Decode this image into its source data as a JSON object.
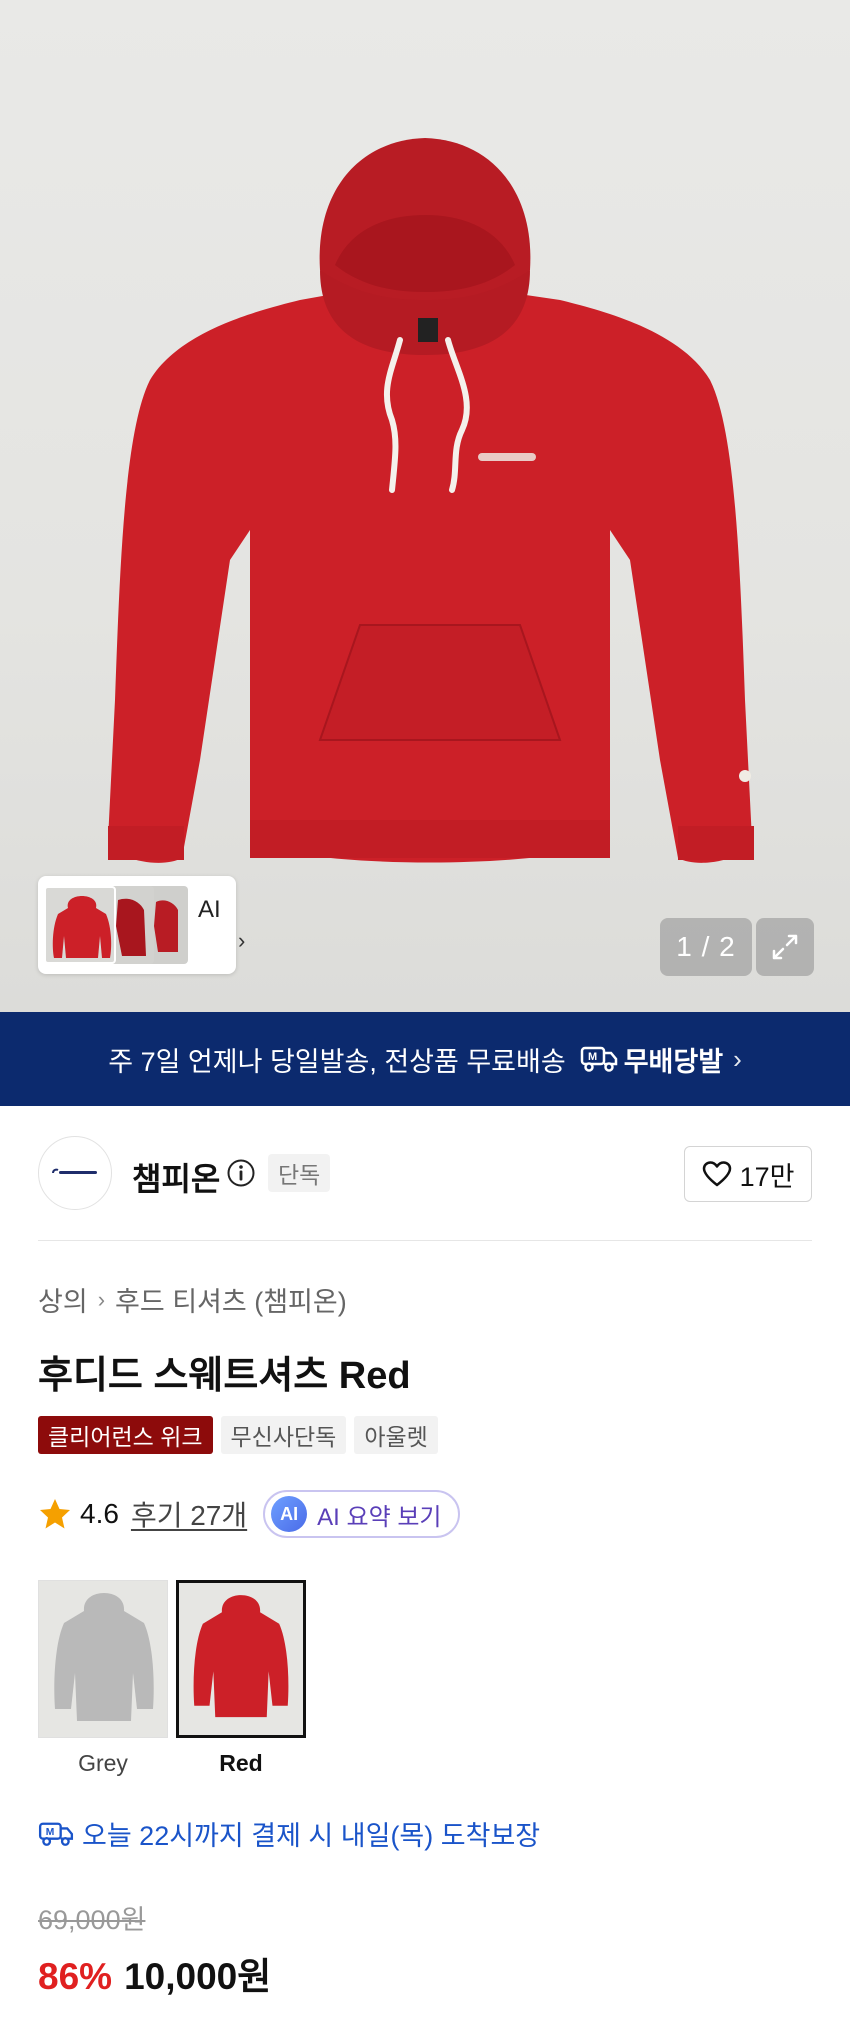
{
  "gallery": {
    "ai_label": "AI",
    "ai_chevron": "›",
    "page_indicator": "1 / 2",
    "expand_icon": "expand-icon"
  },
  "banner": {
    "message": "주 7일 언제나 당일발송, 전상품 무료배송",
    "logo_text": "무배당발",
    "chevron": "›"
  },
  "brand": {
    "name": "챔피온",
    "exclusive_badge": "단독",
    "like_count": "17만"
  },
  "product": {
    "breadcrumb": [
      "상의",
      "후드 티셔츠 (챔피온)"
    ],
    "breadcrumb_sep": "›",
    "title": "후디드 스웨트셔츠 Red",
    "tags": [
      "클리어런스 위크",
      "무신사단독",
      "아울렛"
    ],
    "rating": "4.6",
    "review_link": "후기 27개",
    "ai_badge": "AI",
    "ai_summary": "AI 요약 보기",
    "colors": [
      {
        "label": "Grey",
        "selected": false,
        "hex": "#b9b9b9"
      },
      {
        "label": "Red",
        "selected": true,
        "hex": "#cc2028"
      }
    ],
    "delivery_text": "오늘 22시까지 결제 시 내일(목) 도착보장",
    "original_price": "69,000원",
    "discount": "86%",
    "sale_price": "10,000원"
  },
  "colors": {
    "hoodie_red": "#cc2028",
    "banner_navy": "#0c2a6e",
    "discount_red": "#e02020",
    "delivery_blue": "#1a54c9",
    "tag_red": "#8d0b0b"
  }
}
